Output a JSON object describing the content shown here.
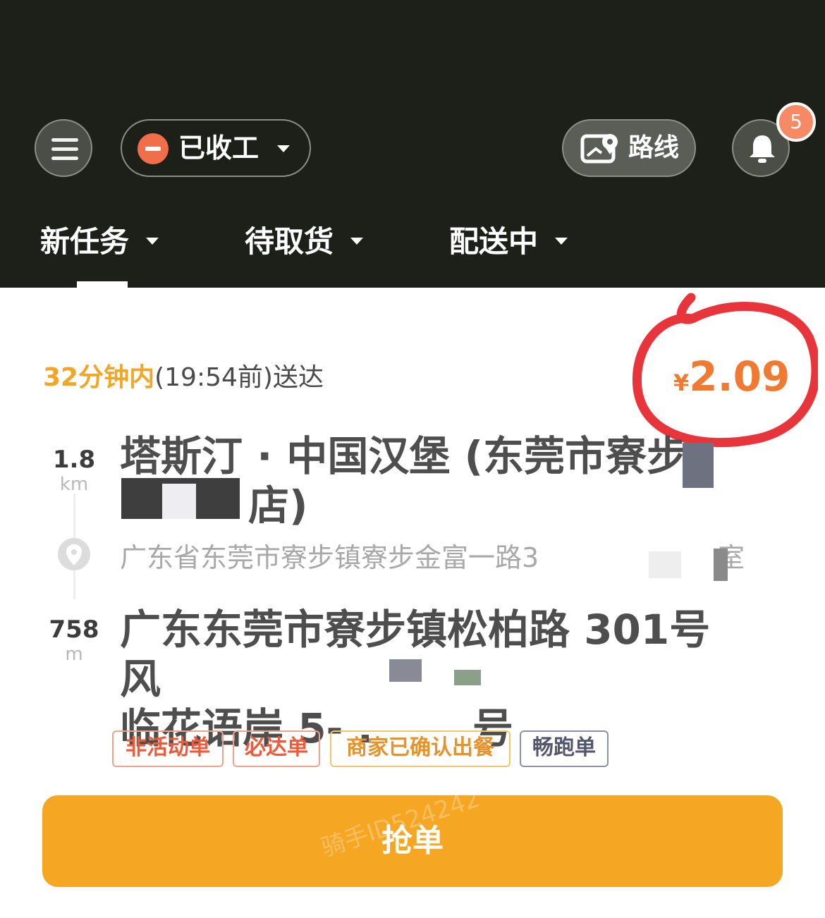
{
  "header": {
    "status_label": "已收工",
    "route_label": "路线",
    "notification_count": "5",
    "tabs": [
      {
        "label": "新任务"
      },
      {
        "label": "待取货"
      },
      {
        "label": "配送中"
      }
    ]
  },
  "order": {
    "deadline_highlight": "32分钟内",
    "deadline_rest": "(19:54前)送达",
    "price_currency": "¥",
    "price_amount": "2.09",
    "pickup": {
      "distance": "1.8",
      "unit": "km",
      "name_line1": "塔斯汀 · 中国汉堡 (东莞市寮步",
      "name_line2": "店)",
      "address": "广东省东莞市寮步镇寮步金富一路3",
      "address_tail": "室"
    },
    "dropoff": {
      "distance": "758",
      "unit": "m",
      "line1": "广东东莞市寮步镇松柏路 301号风",
      "line2": "临花语岸 5- .",
      "line2_tail": "号"
    },
    "tags": [
      "非活动单",
      "必达单",
      "商家已确认出餐",
      "畅跑单"
    ],
    "grab_label": "抢单",
    "watermark": "骑手ID524242"
  },
  "colors": {
    "header_bg": "#1d1f19",
    "accent_orange": "#f5a623",
    "price": "#f07a32",
    "highlight": "#f1a626",
    "annotation_red": "#e8353b"
  }
}
